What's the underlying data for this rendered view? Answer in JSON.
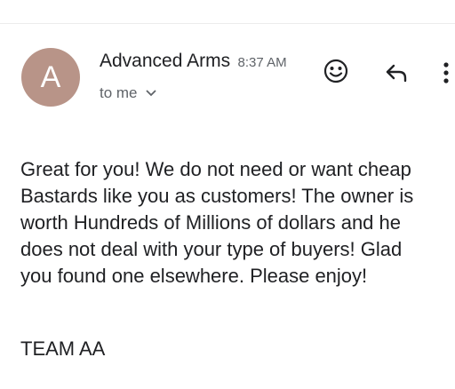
{
  "message": {
    "avatar_initial": "A",
    "sender_name": "Advanced Arms",
    "time": "8:37 AM",
    "recipient_label": "to me",
    "body_lines": [
      "Great for you! We do not need or want cheap",
      "Bastards like you as customers! The owner is",
      "worth Hundreds of Millions of dollars and he",
      "does not deal with your type of buyers! Glad",
      "you found one elsewhere. Please enjoy!"
    ],
    "signature": "TEAM AA"
  },
  "icons": {
    "emoji": "smiley-icon",
    "reply": "reply-arrow-icon",
    "more": "vertical-dots-icon",
    "recipient_toggle": "chevron-down-icon"
  },
  "colors": {
    "avatar_bg": "#b89488",
    "text_primary": "#202124",
    "text_secondary": "#5f6368"
  }
}
